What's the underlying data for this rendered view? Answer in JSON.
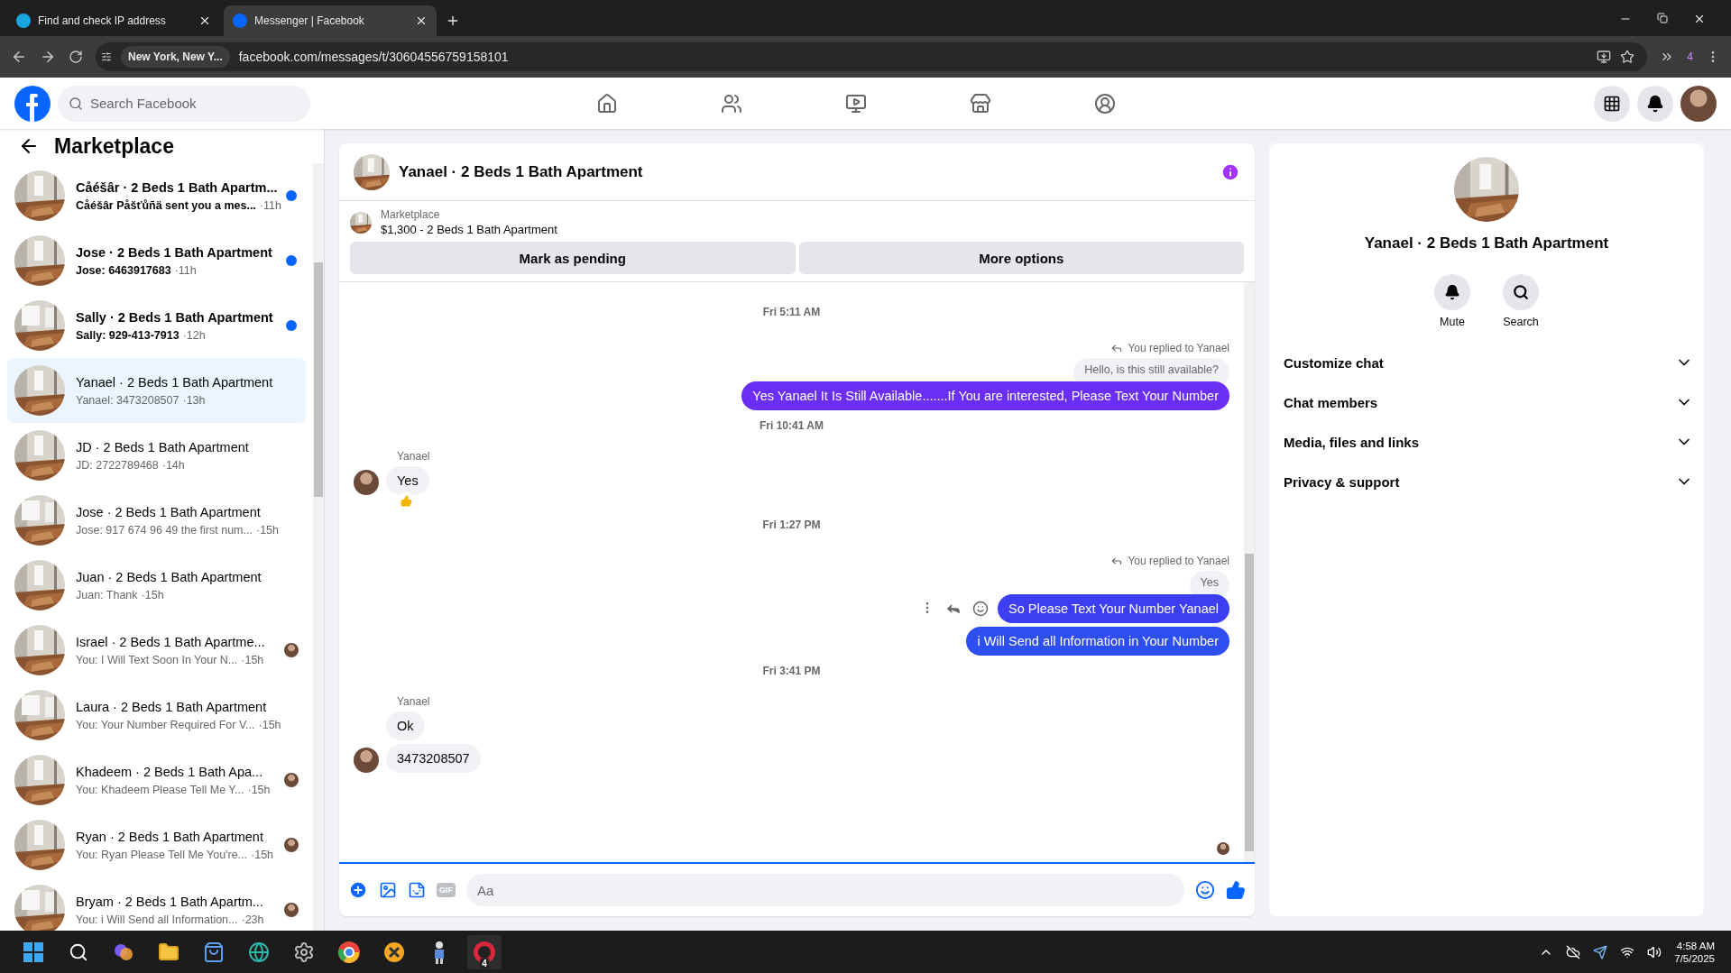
{
  "browser": {
    "tabs": [
      {
        "title": "Find and check IP address",
        "selected": false
      },
      {
        "title": "Messenger | Facebook",
        "selected": true
      }
    ],
    "location": "New York, New Y...",
    "url": "facebook.com/messages/t/30604556759158101",
    "extensions_count": "4"
  },
  "header": {
    "search": {
      "placeholder": "Search Facebook"
    }
  },
  "sidebar": {
    "title": "Marketplace",
    "items": [
      {
        "title": "Cåéšâr · 2 Beds 1 Bath Apartm...",
        "preview": "Cåéšâr Påšťůñä sent you a mes...",
        "time": "·11h",
        "unread": true,
        "seen": false,
        "selected": false
      },
      {
        "title": "Jose · 2 Beds 1 Bath Apartment",
        "preview": "Jose: 6463917683",
        "time": "·11h",
        "unread": true,
        "seen": false,
        "selected": false
      },
      {
        "title": "Sally · 2 Beds 1 Bath Apartment",
        "preview": "Sally: 929-413-7913",
        "time": "·12h",
        "unread": true,
        "seen": false,
        "selected": false
      },
      {
        "title": "Yanael · 2 Beds 1 Bath Apartment",
        "preview": "Yanael: 3473208507",
        "time": "·13h",
        "unread": false,
        "seen": false,
        "selected": true
      },
      {
        "title": "JD · 2 Beds 1 Bath Apartment",
        "preview": "JD: 2722789468",
        "time": "·14h",
        "unread": false,
        "seen": false,
        "selected": false
      },
      {
        "title": "Jose · 2 Beds 1 Bath Apartment",
        "preview": "Jose: 917 674 96 49 the first num...",
        "time": "·15h",
        "unread": false,
        "seen": false,
        "selected": false
      },
      {
        "title": "Juan · 2 Beds 1 Bath Apartment",
        "preview": "Juan: Thank",
        "time": "·15h",
        "unread": false,
        "seen": false,
        "selected": false
      },
      {
        "title": "Israel · 2 Beds 1 Bath Apartme...",
        "preview": "You: I Will Text Soon In Your N...",
        "time": "·15h",
        "unread": false,
        "seen": true,
        "selected": false
      },
      {
        "title": "Laura · 2 Beds 1 Bath Apartment",
        "preview": "You: Your Number Required For V...",
        "time": "·15h",
        "unread": false,
        "seen": false,
        "selected": false
      },
      {
        "title": "Khadeem · 2 Beds 1 Bath Apa...",
        "preview": "You: Khadeem Please Tell Me Y...",
        "time": "·15h",
        "unread": false,
        "seen": true,
        "selected": false
      },
      {
        "title": "Ryan · 2 Beds 1 Bath Apartment",
        "preview": "You: Ryan Please Tell Me You're...",
        "time": "·15h",
        "unread": false,
        "seen": true,
        "selected": false
      },
      {
        "title": "Bryam · 2 Beds 1 Bath Apartm...",
        "preview": "You: i Will Send all Information...",
        "time": "·23h",
        "unread": false,
        "seen": true,
        "selected": false
      }
    ]
  },
  "chat": {
    "title": "Yanael · 2 Beds 1 Bath Apartment",
    "listing": {
      "label": "Marketplace",
      "name": "$1,300 - 2 Beds 1 Bath Apartment"
    },
    "actions": [
      "Mark as pending",
      "More options"
    ],
    "messages": [
      {
        "kind": "time",
        "text": "Fri 5:11 AM"
      },
      {
        "kind": "reply_note",
        "text": "You replied to Yanael"
      },
      {
        "kind": "quoted",
        "text": "Hello, is this still available?"
      },
      {
        "kind": "sent",
        "text": "Yes Yanael It Is Still Available.......If You are interested, Please Text Your Number",
        "color": "#6b2ef5",
        "show_actions": false
      },
      {
        "kind": "time",
        "text": "Fri 10:41 AM"
      },
      {
        "kind": "received",
        "sender": "Yanael",
        "text": "Yes",
        "avatar": true,
        "reacted": true
      },
      {
        "kind": "time",
        "text": "Fri 1:27 PM"
      },
      {
        "kind": "reply_note",
        "text": "You replied to Yanael"
      },
      {
        "kind": "quoted",
        "text": "Yes"
      },
      {
        "kind": "sent",
        "text": "So Please Text Your Number Yanael",
        "color": "#3d3ef2",
        "show_actions": true
      },
      {
        "kind": "sent",
        "text": "i Will Send all Information in Your Number",
        "color": "#2d4ef0",
        "show_actions": false
      },
      {
        "kind": "time",
        "text": "Fri 3:41 PM"
      },
      {
        "kind": "received",
        "sender": "Yanael",
        "text": "Ok",
        "avatar": false,
        "reacted": false
      },
      {
        "kind": "received",
        "text": "3473208507",
        "avatar": true,
        "reacted": false
      }
    ],
    "seen": true,
    "composer": {
      "gif_label": "GIF",
      "placeholder": "Aa"
    }
  },
  "details": {
    "title": "Yanael · 2 Beds 1 Bath Apartment",
    "buttons": [
      {
        "kind": "mute",
        "label": "Mute"
      },
      {
        "kind": "search",
        "label": "Search"
      }
    ],
    "sections": [
      {
        "label": "Customize chat",
        "expanded": false
      },
      {
        "label": "Chat members",
        "expanded": false
      },
      {
        "label": "Media, files and links",
        "expanded": false
      },
      {
        "label": "Privacy & support",
        "expanded": false
      }
    ]
  },
  "taskbar": {
    "badge": "4",
    "time": "4:58 AM",
    "date": "7/5/2025"
  }
}
